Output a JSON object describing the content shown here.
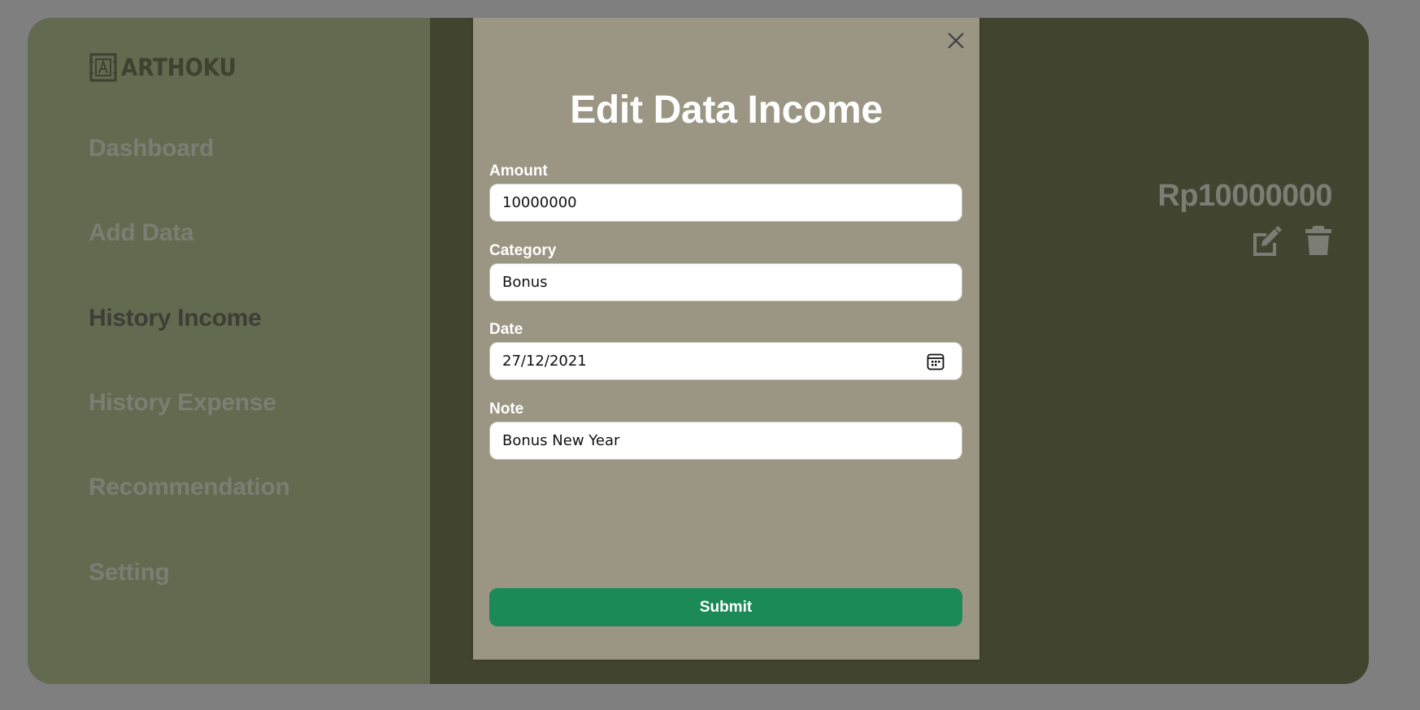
{
  "app": {
    "logo_text": "ARTHOKU"
  },
  "sidebar": {
    "items": [
      {
        "label": "Dashboard",
        "active": false
      },
      {
        "label": "Add Data",
        "active": false
      },
      {
        "label": "History Income",
        "active": true
      },
      {
        "label": "History Expense",
        "active": false
      },
      {
        "label": "Recommendation",
        "active": false
      },
      {
        "label": "Setting",
        "active": false
      }
    ]
  },
  "main": {
    "income_amount": "Rp10000000",
    "actions": {
      "edit_icon": "edit-icon",
      "delete_icon": "trash-icon"
    }
  },
  "modal": {
    "title": "Edit Data Income",
    "close_icon": "close-icon",
    "fields": {
      "amount": {
        "label": "Amount",
        "value": "10000000"
      },
      "category": {
        "label": "Category",
        "value": "Bonus"
      },
      "date": {
        "label": "Date",
        "value": "27/12/2021",
        "icon": "calendar-icon"
      },
      "note": {
        "label": "Note",
        "value": "Bonus New Year"
      }
    },
    "submit_label": "Submit"
  },
  "colors": {
    "overlay": "#7f7f7f",
    "sidebar": "#626a50",
    "content": "#41452f",
    "modal": "#9b9583",
    "submit": "#1b8a57"
  }
}
